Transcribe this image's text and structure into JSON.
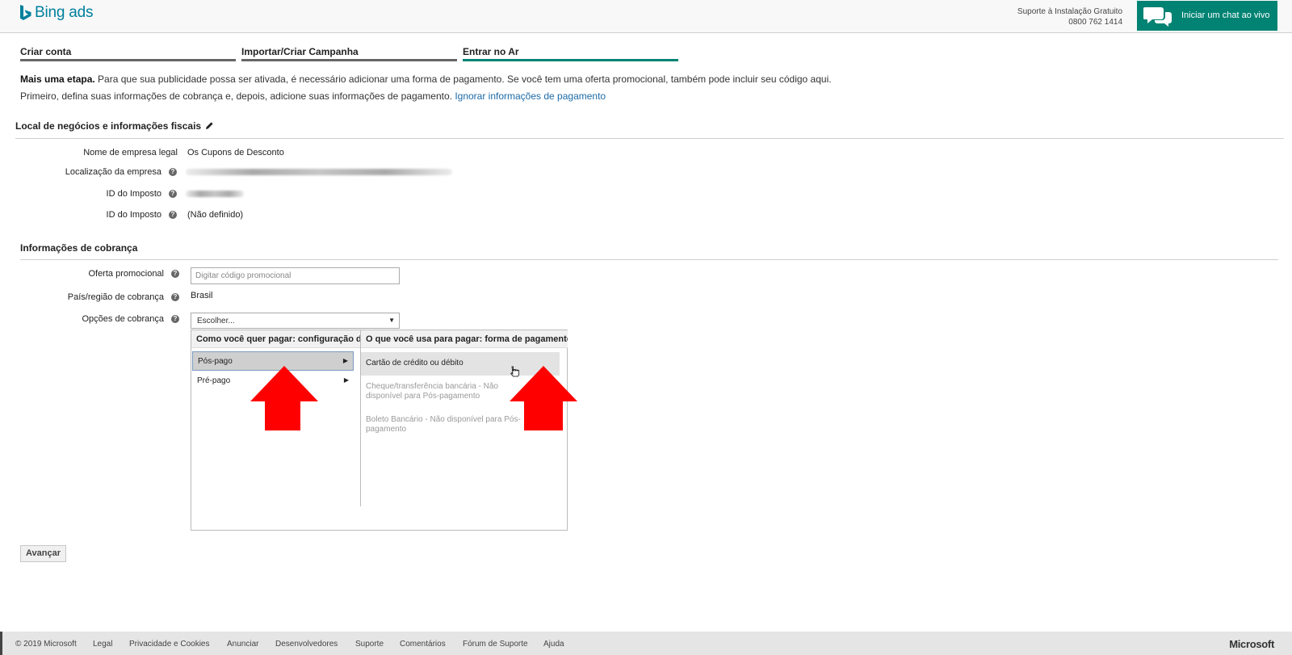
{
  "header": {
    "logo_text": "Bing ads",
    "support_line1": "Suporte à Instalação Gratuito",
    "support_phone": "0800 762 1414",
    "chat_label": "Iniciar um chat ao vivo",
    "accent_color": "#008373"
  },
  "steps": [
    {
      "label": "Criar conta",
      "active": false
    },
    {
      "label": "Importar/Criar Campanha",
      "active": false
    },
    {
      "label": "Entrar no Ar",
      "active": true
    }
  ],
  "intro": {
    "bold": "Mais uma etapa.",
    "text1": " Para que sua publicidade possa ser ativada, é necessário adicionar uma forma de pagamento. Se você tem uma oferta promocional, também pode incluir seu código aqui.",
    "text2": "Primeiro, defina suas informações de cobrança e, depois, adicione suas informações de pagamento. ",
    "link": "Ignorar informações de pagamento"
  },
  "business": {
    "title": "Local de negócios e informações fiscais",
    "rows": [
      {
        "label": "Nome de empresa legal",
        "value": "Os Cupons de Desconto"
      },
      {
        "label": "Localização da empresa",
        "value": ""
      },
      {
        "label": "ID do Imposto",
        "value": ""
      },
      {
        "label": "ID do Imposto",
        "value": "(Não definido)"
      }
    ]
  },
  "billing": {
    "title": "Informações de cobrança",
    "promo_label": "Oferta promocional",
    "promo_placeholder": "Digitar código promocional",
    "country_label": "País/região de cobrança",
    "country_value": "Brasil",
    "options_label": "Opções de cobrança",
    "select_value": "Escolher..."
  },
  "dropdown": {
    "left_header": "Como você quer pagar: configuração de pagamento",
    "right_header": "O que você usa para pagar: forma de pagamento",
    "left_options": [
      {
        "label": "Pós-pago",
        "selected": true
      },
      {
        "label": "Pré-pago",
        "selected": false
      }
    ],
    "right_options": [
      {
        "label": "Cartão de crédito ou débito",
        "disabled": false
      },
      {
        "label": "Cheque/transferência bancária - Não disponível para Pós-pagamento",
        "disabled": true
      },
      {
        "label": "Boleto Bancário - Não disponível para Pós-pagamento",
        "disabled": true
      }
    ]
  },
  "next_button": "Avançar",
  "footer": {
    "items": [
      "© 2019 Microsoft",
      "Legal",
      "Privacidade e Cookies",
      "Anunciar",
      "Desenvolvedores",
      "Suporte",
      "Comentários",
      "Fórum de Suporte",
      "Ajuda"
    ],
    "brand": "Microsoft"
  }
}
